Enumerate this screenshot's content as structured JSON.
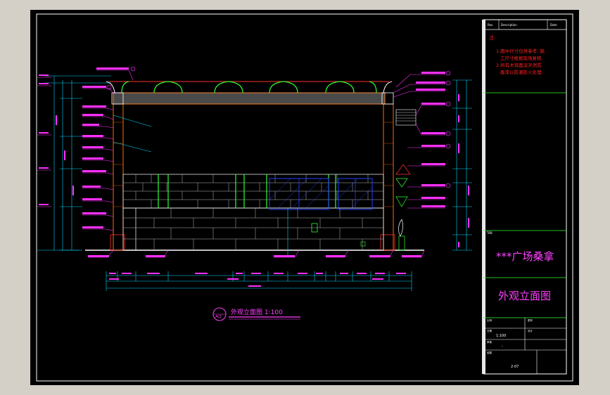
{
  "colors": {
    "background": "#000000",
    "frame": "#ffffff",
    "note_text": "#ff2020",
    "dim": "#00d8ff",
    "leader": "#ff30ff",
    "wall": "#ffffff",
    "column": "#ff6a00",
    "window_frame": "#30ff30",
    "glass": "#2040ff",
    "title": "#ff40ff",
    "outline": "#30ff30"
  },
  "title_block": {
    "header_cells": [
      "Rev",
      "Description",
      "Date"
    ],
    "note_label": "注:",
    "notes": [
      "1.图中尺寸仅供参考, 施",
      "工尺寸根据现场复核.",
      "2.所有木饰面涂天然防",
      "腐漆以防潮防火处理."
    ],
    "section_tag": "TAB",
    "project_name": "***广场桑拿",
    "drawing_name": "外观立面图",
    "row_labels": [
      "比例",
      "图号",
      "日期",
      "设计",
      "审核",
      "绘图"
    ],
    "scale_value": "1:100",
    "dash_value": "-",
    "sheet_number": "2-07"
  },
  "drawing": {
    "title": "外观立面图  1:100",
    "tag": "A/2"
  }
}
